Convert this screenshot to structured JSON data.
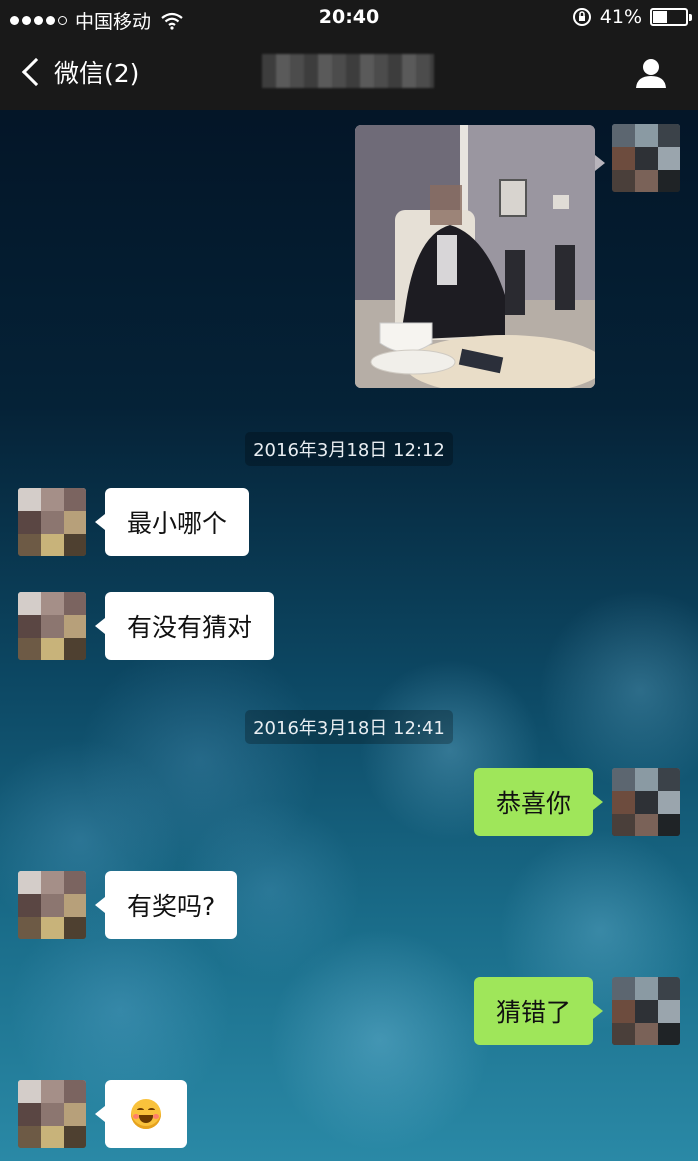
{
  "status_bar": {
    "carrier": "中国移动",
    "time": "20:40",
    "battery": "41%",
    "battery_level": 0.41
  },
  "nav": {
    "back_label": "微信(2)",
    "title_obscured": true
  },
  "messages": {
    "ts1": "2016年3月18日 12:12",
    "ts2": "2016年3月18日 12:41",
    "m1": "最小哪个",
    "m2": "有没有猜对",
    "m3": "恭喜你",
    "m4": "有奖吗?",
    "m5": "猜错了",
    "m6_emoji": "grinning-squint-emoji"
  },
  "colors": {
    "bar_bg": "#191919",
    "bubble_left": "#ffffff",
    "bubble_right": "#9fe65a"
  }
}
